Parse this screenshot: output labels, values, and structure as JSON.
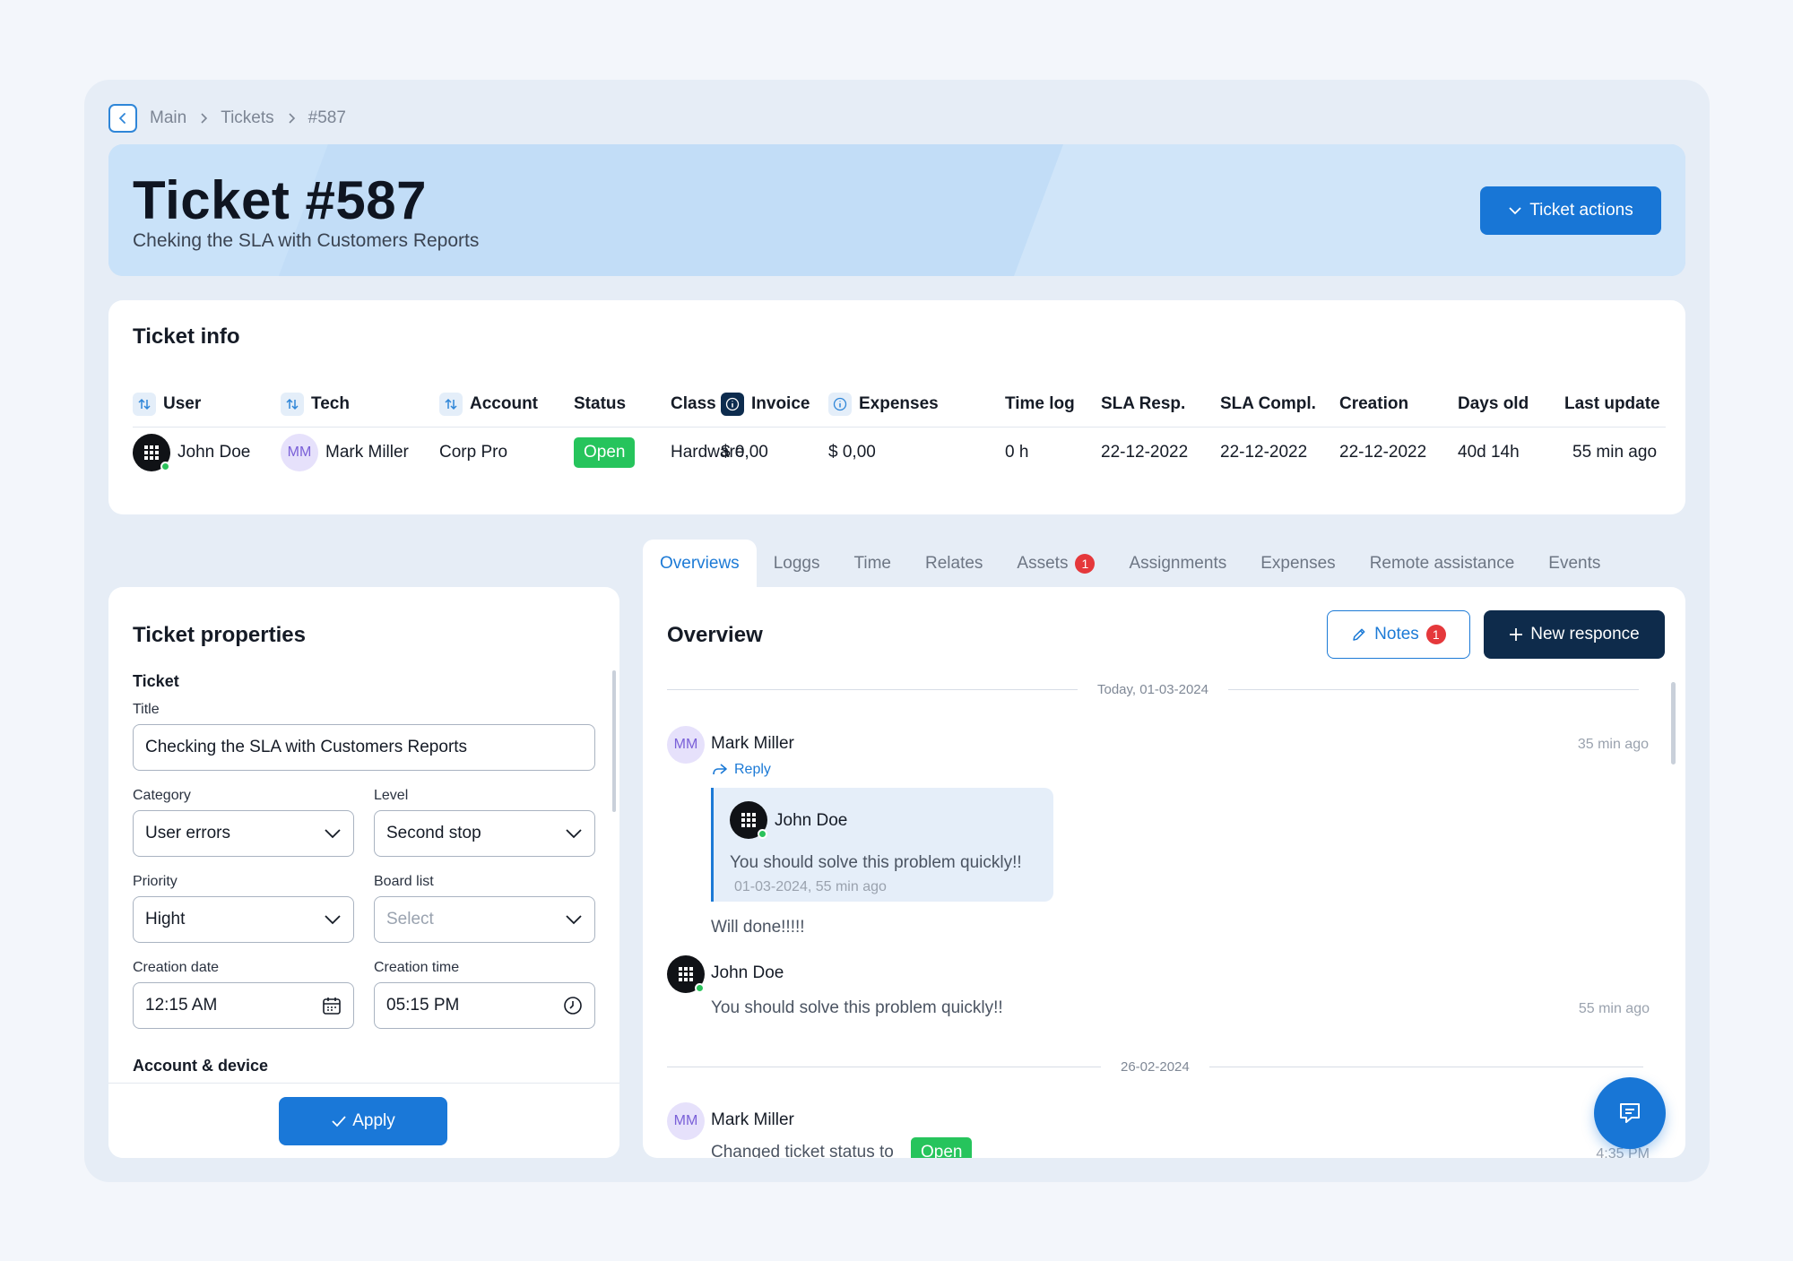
{
  "breadcrumb": {
    "items": [
      "Main",
      "Tickets",
      "#587"
    ]
  },
  "header": {
    "title": "Ticket #587",
    "subtitle": "Cheking the SLA with Customers Reports",
    "actions_label": "Ticket actions"
  },
  "ticket_info": {
    "title": "Ticket info",
    "columns": [
      "User",
      "Tech",
      "Account",
      "Status",
      "Class",
      "Invoice",
      "Expenses",
      "Time log",
      "SLA Resp.",
      "SLA Compl.",
      "Creation",
      "Days old",
      "Last update"
    ],
    "row": {
      "user": "John Doe",
      "tech_initials": "MM",
      "tech": "Mark Miller",
      "account": "Corp Pro",
      "status": "Open",
      "class": "Hardware",
      "invoice": "$ 0,00",
      "expenses": "$ 0,00",
      "time_log": "0 h",
      "sla_resp": "22-12-2022",
      "sla_compl": "22-12-2022",
      "creation": "22-12-2022",
      "days_old": "40d 14h",
      "last_update": "55 min ago"
    }
  },
  "tabs": [
    {
      "label": "Overviews",
      "active": true
    },
    {
      "label": "Loggs"
    },
    {
      "label": "Time"
    },
    {
      "label": "Relates"
    },
    {
      "label": "Assets",
      "count": "1"
    },
    {
      "label": "Assignments"
    },
    {
      "label": "Expenses"
    },
    {
      "label": "Remote assistance"
    },
    {
      "label": "Events"
    }
  ],
  "properties": {
    "title": "Ticket properties",
    "section_ticket": "Ticket",
    "title_label": "Title",
    "title_value": "Checking the SLA with Customers Reports",
    "category_label": "Category",
    "category_value": "User errors",
    "level_label": "Level",
    "level_value": "Second stop",
    "priority_label": "Priority",
    "priority_value": "Hight",
    "board_label": "Board list",
    "board_placeholder": "Select",
    "date_label": "Creation date",
    "date_value": "12:15 AM",
    "time_label": "Creation time",
    "time_value": "05:15 PM",
    "section_account": "Account & device",
    "apply_label": "Apply"
  },
  "overview": {
    "title": "Overview",
    "notes_label": "Notes",
    "notes_count": "1",
    "new_response_label": "New responce",
    "date_today": "Today, 01-03-2024",
    "date_prev": "26-02-2024",
    "messages": [
      {
        "initials": "MM",
        "author": "Mark Miller",
        "time": "35 min ago",
        "reply_label": "Reply",
        "quote_author": "John Doe",
        "quote_text": "You should solve this problem quickly!!",
        "quote_meta": "01-03-2024, 55 min ago",
        "text": "Will done!!!!!"
      },
      {
        "author": "John Doe",
        "text": "You should solve this problem quickly!!",
        "time": "55 min ago"
      },
      {
        "initials": "MM",
        "author": "Mark Miller",
        "text": "Changed ticket status to",
        "status": "Open",
        "time": "4:35 PM"
      }
    ]
  },
  "colors": {
    "accent": "#1876d6",
    "navy": "#0e2b4b",
    "success": "#26c45c",
    "danger": "#e5383b"
  }
}
